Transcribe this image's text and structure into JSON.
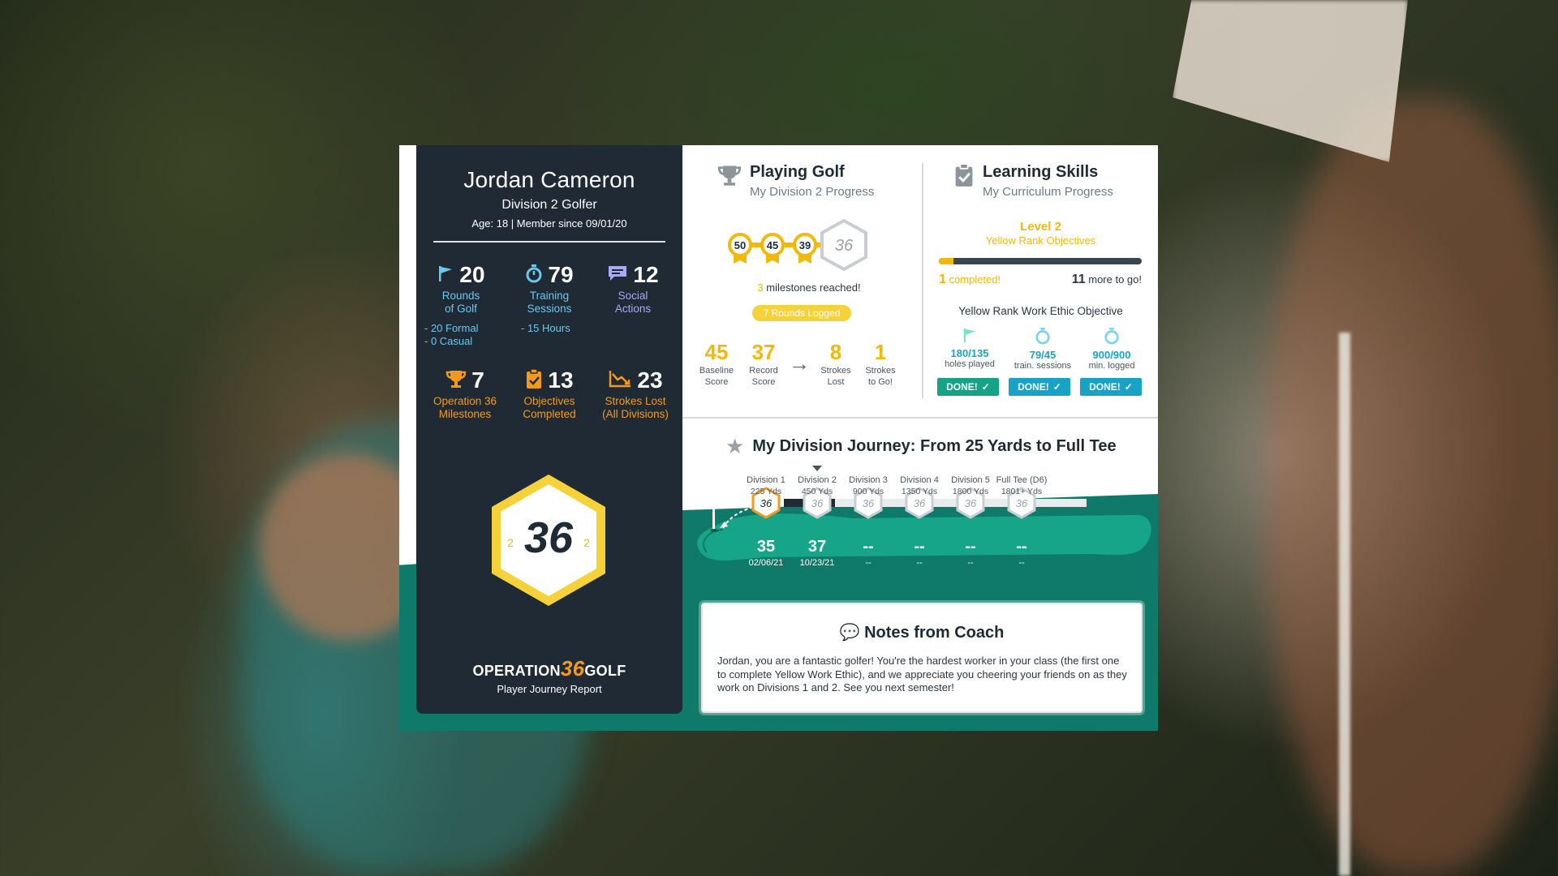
{
  "player": {
    "name": "Jordan Cameron",
    "division": "Division 2 Golfer",
    "meta": "Age: 18 | Member since 09/01/20"
  },
  "stats": {
    "rounds": {
      "value": "20",
      "label1": "Rounds",
      "label2": "of Golf",
      "sub1": "- 20 Formal",
      "sub2": "- 0 Casual"
    },
    "training": {
      "value": "79",
      "label1": "Training",
      "label2": "Sessions",
      "sub1": "- 15 Hours"
    },
    "social": {
      "value": "12",
      "label1": "Social",
      "label2": "Actions"
    },
    "milestones": {
      "value": "7",
      "label1": "Operation 36",
      "label2": "Milestones"
    },
    "objectives": {
      "value": "13",
      "label1": "Objectives",
      "label2": "Completed"
    },
    "strokes": {
      "value": "23",
      "label1": "Strokes Lost",
      "label2": "(All Divisions)"
    }
  },
  "badge": {
    "center": "36",
    "left": "2",
    "right": "2"
  },
  "brand": {
    "name_left": "OPERATION",
    "name_mid": "36",
    "name_right": "GOLF",
    "tagline": "Player Journey Report"
  },
  "playing": {
    "title": "Playing Golf",
    "subtitle": "My Division 2 Progress",
    "milestone_scores": [
      "50",
      "45",
      "39"
    ],
    "milestone_hex": "36",
    "milestones_count": "3",
    "milestones_text": "milestones reached!",
    "rounds_pill": "7 Rounds Logged",
    "baseline": {
      "value": "45",
      "label1": "Baseline",
      "label2": "Score"
    },
    "record": {
      "value": "37",
      "label1": "Record",
      "label2": "Score"
    },
    "lost": {
      "value": "8",
      "label1": "Strokes",
      "label2": "Lost"
    },
    "togo": {
      "value": "1",
      "label1": "Strokes",
      "label2": "to Go!"
    },
    "arrow": "→"
  },
  "learning": {
    "title": "Learning Skills",
    "subtitle": "My Curriculum Progress",
    "level": "Level 2",
    "rank": "Yellow Rank Objectives",
    "progress": 0.07,
    "completed_n": "1",
    "completed_text": "completed!",
    "more_n": "11",
    "more_text": "more to go!",
    "objective_title": "Yellow Rank Work Ethic Objective",
    "items": [
      {
        "value": "180/135",
        "label": "holes played",
        "done": "DONE!"
      },
      {
        "value": "79/45",
        "label": "train. sessions",
        "done": "DONE!"
      },
      {
        "value": "900/900",
        "label": "min. logged",
        "done": "DONE!"
      }
    ]
  },
  "journey": {
    "title": "My Division Journey: From 25 Yards to Full Tee",
    "divisions": [
      {
        "name": "Division 1",
        "yards": "225 Yds",
        "score": "35",
        "date": "02/06/21"
      },
      {
        "name": "Division 2",
        "yards": "450 Yds",
        "score": "37",
        "date": "10/23/21"
      },
      {
        "name": "Division 3",
        "yards": "900 Yds",
        "score": "--",
        "date": "--"
      },
      {
        "name": "Division 4",
        "yards": "1350 Yds",
        "score": "--",
        "date": "--"
      },
      {
        "name": "Division 5",
        "yards": "1800 Yds",
        "score": "--",
        "date": "--"
      },
      {
        "name": "Full Tee (D6)",
        "yards": "1801+ Yds",
        "score": "--",
        "date": "--"
      }
    ],
    "hex_label": "36"
  },
  "notes": {
    "title": "Notes from Coach",
    "body": "Jordan, you are a fantastic golfer! You're the hardest worker in your class (the first one to complete Yellow Work Ethic), and we appreciate you cheering your friends on as they work on Divisions 1 and 2. See you next semester!"
  },
  "colors": {
    "navy": "#1f2a34",
    "teal": "#0f7a6a",
    "yellow": "#f2b90b",
    "orange": "#f39a1e",
    "blue": "#6ec6ee",
    "done": "#18a3c6"
  }
}
